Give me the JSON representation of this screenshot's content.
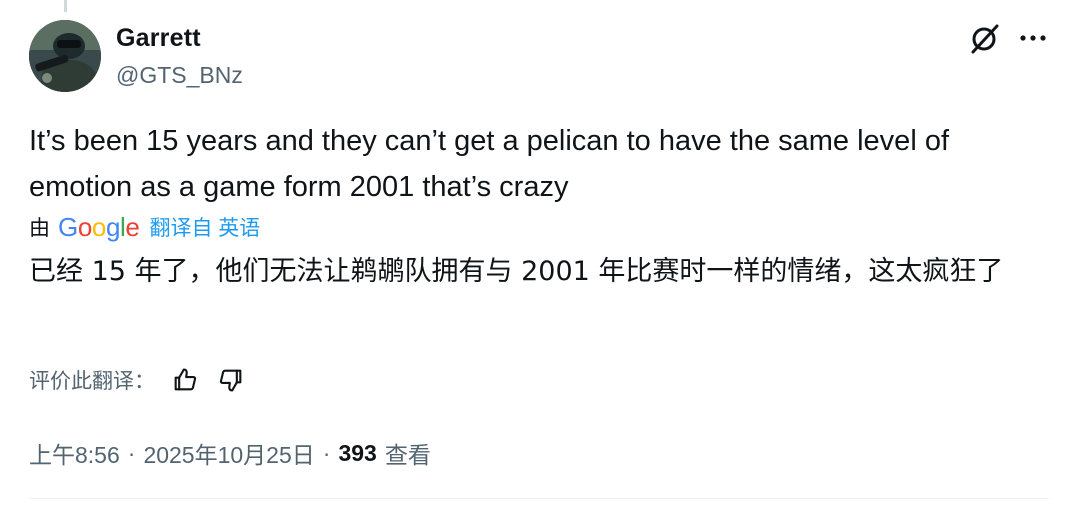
{
  "tweet": {
    "author": {
      "name": "Garrett",
      "handle": "@GTS_BNz",
      "avatar_icon": "avatar-photo-soldier"
    },
    "header_actions": {
      "grok_icon": "grok-slash-circle-icon",
      "more_icon": "more-horizontal-icon",
      "more_label": "•••"
    },
    "text": "It’s been 15 years and they can’t get a pelican to have the same level of emotion as a game form 2001 that’s crazy",
    "translation": {
      "by_label": "由",
      "provider": "Google",
      "link_label": "翻译自 英语",
      "translated_text": "已经 15 年了，他们无法让鹈鹕队拥有与 2001 年比赛时一样的情绪，这太疯狂了"
    },
    "rate": {
      "label": "评价此翻译：",
      "thumbs_up_icon": "thumbs-up-icon",
      "thumbs_down_icon": "thumbs-down-icon"
    },
    "meta": {
      "time": "上午8:56",
      "separator": "·",
      "date": "2025年10月25日",
      "views_count": "393",
      "views_label": "查看"
    }
  },
  "colors": {
    "text_primary": "#0f1419",
    "text_secondary": "#536471",
    "link_blue": "#1d9bf0",
    "divider": "#eff3f4"
  }
}
